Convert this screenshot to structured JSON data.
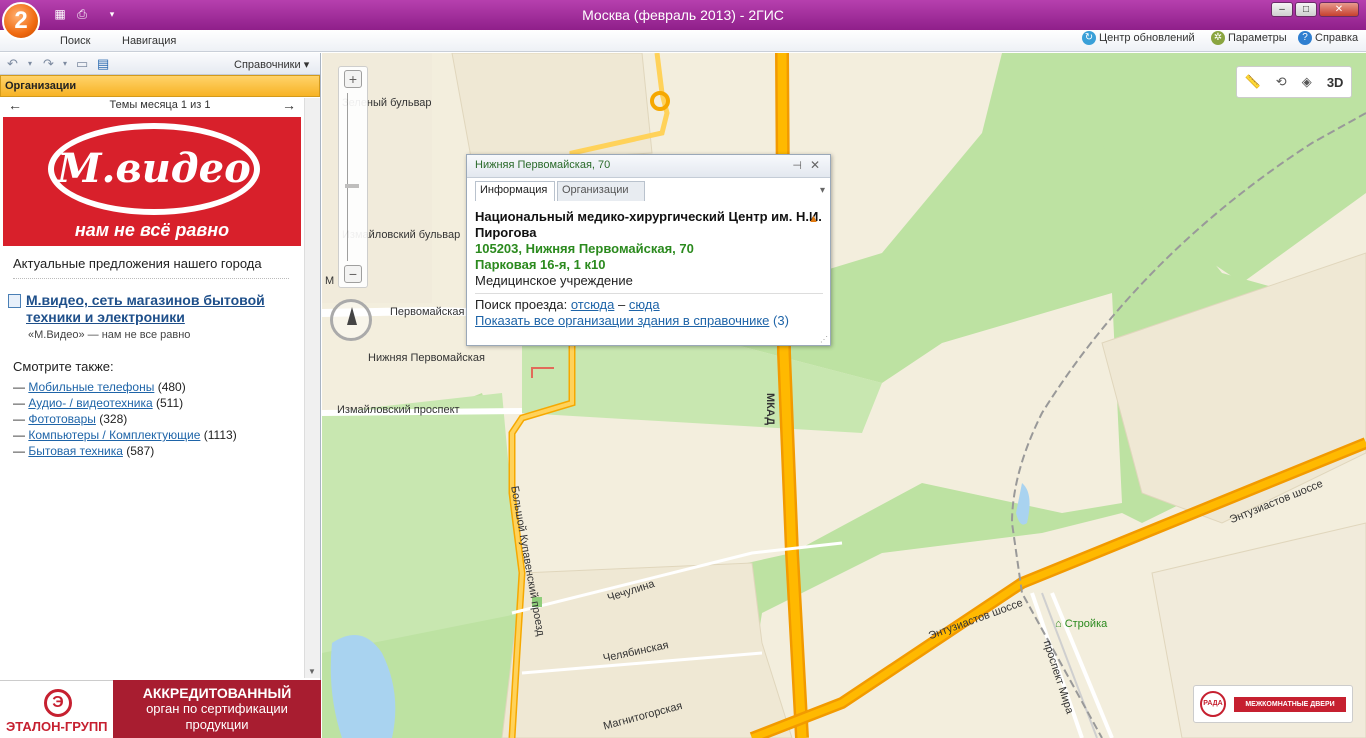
{
  "window": {
    "title": "Москва (февраль 2013) - 2ГИС",
    "logo_glyph": "2"
  },
  "menu": {
    "items": [
      "Поиск",
      "Навигация"
    ],
    "updates": "Центр обновлений",
    "settings": "Параметры",
    "help": "Справка"
  },
  "toolbar": {
    "directories": "Справочники"
  },
  "sidebar": {
    "section_title": "Организации",
    "themes_label": "Темы месяца 1 из 1",
    "banner": {
      "brand": "М.видео",
      "slogan": "нам не всё равно"
    },
    "offers_title": "Актуальные предложения нашего города",
    "main_link": "М.видео, сеть магазинов бытовой техники и электроники",
    "main_sub": "«М.Видео» — нам не все равно",
    "see_also": "Смотрите также:",
    "categories": [
      {
        "name": "Мобильные телефоны",
        "count": "(480)"
      },
      {
        "name": "Аудио- / видеотехника",
        "count": "(511)"
      },
      {
        "name": "Фототовары",
        "count": "(328)"
      },
      {
        "name": "Компьютеры / Комплектующие",
        "count": "(1113)"
      },
      {
        "name": "Бытовая техника",
        "count": "(587)"
      }
    ],
    "ad_left": "ЭТАЛОН-ГРУПП",
    "ad_right": {
      "head": "АККРЕДИТОВАННЫЙ",
      "line2": "орган по сертификации",
      "line3": "продукции"
    }
  },
  "popup": {
    "title": "Нижняя Первомайская, 70",
    "tab_info": "Информация",
    "tab_orgs": "Организации",
    "org_name": "Национальный медико-хирургический Центр им. Н.И. Пирогова",
    "addr1": "105203, Нижняя Первомайская, 70",
    "addr2": "Парковая 16-я, 1 к10",
    "category": "Медицинское учреждение",
    "route_label": "Поиск проезда:",
    "route_from": "отсюда",
    "route_dash": "–",
    "route_to": "сюда",
    "show_all": "Показать все организации здания в справочнике",
    "show_all_count": "(3)"
  },
  "map": {
    "ctl_3d": "3D",
    "labels": {
      "izmaylovsky_boulevard": "Измайловский бульвар",
      "green_boulevard": "Зеленый бульвар",
      "pervomayskaya": "Первомайская",
      "nizh_pervomayskaya": "Нижняя Первомайская",
      "izmaylovsky_prospect": "Измайловский проспект",
      "mkad": "МКАД",
      "bolshoy_kupavensky": "Большой Купавенский проезд",
      "chechulina": "Чечулина",
      "chelyabinskaya": "Челябинская",
      "magnitogorskaya": "Магнитогорская",
      "entuziastov_1": "Энтузиастов шоссе",
      "entuziastov_2": "Энтузиастов шоссе",
      "prospect_mira": "проспект Мира",
      "stroyka": "Стройка",
      "m_edge": "М"
    },
    "ad": "МЕЖКОМНАТНЫЕ ДВЕРИ"
  },
  "colors": {
    "titlebar": "#a32e9d",
    "accent_orange": "#f7b325",
    "road": "#f6a800",
    "park": "#bde2a2",
    "map_bg": "#f3eedd",
    "link": "#1e64a8",
    "green_text": "#2b8a1e"
  }
}
